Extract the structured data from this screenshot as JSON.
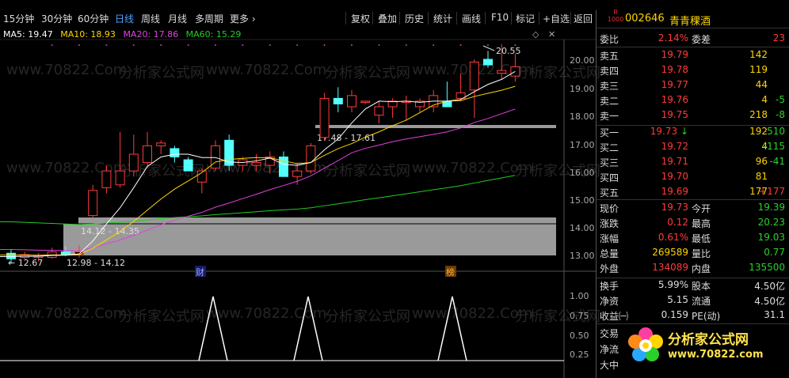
{
  "toolbar": {
    "periods": [
      "15分钟",
      "30分钟",
      "60分钟",
      "日线",
      "周线",
      "月线",
      "多周期",
      "更多 ›"
    ],
    "active_period": "日线",
    "buttons": [
      "复权",
      "叠加",
      "历史",
      "统计",
      "画线",
      "F10",
      "标记",
      "+自选",
      "返回"
    ]
  },
  "ma_legend": {
    "ma5": "MA5: 19.47",
    "ma10": "MA10: 18.93",
    "ma20": "MA20: 17.86",
    "ma60": "MA60: 15.29",
    "colors": {
      "ma5": "#ffffff",
      "ma10": "#ffd400",
      "ma20": "#e040e0",
      "ma60": "#22cc22"
    }
  },
  "chart_data": {
    "type": "candlestick",
    "price_axis_ticks": [
      "20.00",
      "19.00",
      "18.00",
      "17.00",
      "16.00",
      "15.00",
      "14.00",
      "13.00"
    ],
    "ylim": [
      12.6,
      20.9
    ],
    "annotations": {
      "high_label": "20.55",
      "low_label": "← 12.67",
      "range_band_top": "17.48 - 17.61",
      "range_band_mid": "14.12 - 14.35",
      "range_band_low": "12.98 - 14.12"
    },
    "event_markers": [
      "财",
      "榜"
    ],
    "indicator_axis_ticks": [
      "1.00",
      "0.75",
      "0.50",
      "0.25"
    ],
    "indicator_peaks": [
      0,
      0,
      1,
      0,
      0,
      1,
      0,
      0,
      1,
      0
    ],
    "candles": [
      {
        "o": 13.05,
        "h": 13.2,
        "l": 12.67,
        "c": 12.85
      },
      {
        "o": 12.9,
        "h": 13.1,
        "l": 12.8,
        "c": 13.0
      },
      {
        "o": 12.9,
        "h": 13.05,
        "l": 12.75,
        "c": 12.95
      },
      {
        "o": 12.9,
        "h": 13.25,
        "l": 12.85,
        "c": 13.1
      },
      {
        "o": 13.1,
        "h": 13.3,
        "l": 12.95,
        "c": 13.0
      },
      {
        "o": 13.0,
        "h": 13.35,
        "l": 12.9,
        "c": 13.1
      },
      {
        "o": 14.4,
        "h": 15.5,
        "l": 14.3,
        "c": 15.3
      },
      {
        "o": 15.4,
        "h": 16.2,
        "l": 15.2,
        "c": 16.0
      },
      {
        "o": 15.5,
        "h": 17.4,
        "l": 15.4,
        "c": 16.0
      },
      {
        "o": 16.0,
        "h": 17.3,
        "l": 15.8,
        "c": 16.6
      },
      {
        "o": 16.3,
        "h": 17.4,
        "l": 16.1,
        "c": 16.9
      },
      {
        "o": 16.9,
        "h": 17.1,
        "l": 16.6,
        "c": 17.0
      },
      {
        "o": 16.8,
        "h": 16.9,
        "l": 16.3,
        "c": 16.5
      },
      {
        "o": 16.4,
        "h": 16.5,
        "l": 16.0,
        "c": 16.0
      },
      {
        "o": 15.6,
        "h": 16.1,
        "l": 15.2,
        "c": 16.0
      },
      {
        "o": 16.1,
        "h": 17.1,
        "l": 16.0,
        "c": 16.9
      },
      {
        "o": 17.1,
        "h": 17.3,
        "l": 16.0,
        "c": 16.2
      },
      {
        "o": 16.2,
        "h": 16.5,
        "l": 16.0,
        "c": 16.4
      },
      {
        "o": 16.2,
        "h": 16.6,
        "l": 16.0,
        "c": 16.3
      },
      {
        "o": 16.2,
        "h": 16.7,
        "l": 15.9,
        "c": 16.5
      },
      {
        "o": 16.5,
        "h": 16.7,
        "l": 15.8,
        "c": 15.8
      },
      {
        "o": 15.8,
        "h": 16.3,
        "l": 15.5,
        "c": 16.0
      },
      {
        "o": 16.0,
        "h": 17.0,
        "l": 15.9,
        "c": 16.9
      },
      {
        "o": 17.2,
        "h": 18.8,
        "l": 17.1,
        "c": 18.6
      },
      {
        "o": 18.6,
        "h": 19.0,
        "l": 18.1,
        "c": 18.4
      },
      {
        "o": 18.3,
        "h": 18.9,
        "l": 18.1,
        "c": 18.7
      },
      {
        "o": 18.5,
        "h": 18.5,
        "l": 18.4,
        "c": 18.5
      },
      {
        "o": 18.0,
        "h": 18.5,
        "l": 17.7,
        "c": 18.3
      },
      {
        "o": 18.3,
        "h": 18.6,
        "l": 17.9,
        "c": 18.5
      },
      {
        "o": 18.5,
        "h": 18.7,
        "l": 17.8,
        "c": 18.5
      },
      {
        "o": 18.3,
        "h": 18.6,
        "l": 18.1,
        "c": 18.5
      },
      {
        "o": 18.3,
        "h": 18.9,
        "l": 18.1,
        "c": 18.7
      },
      {
        "o": 18.5,
        "h": 19.2,
        "l": 18.3,
        "c": 18.3
      },
      {
        "o": 18.6,
        "h": 19.5,
        "l": 18.5,
        "c": 18.8
      },
      {
        "o": 18.9,
        "h": 20.0,
        "l": 17.9,
        "c": 19.9
      },
      {
        "o": 20.0,
        "h": 20.3,
        "l": 19.7,
        "c": 19.8
      },
      {
        "o": 19.5,
        "h": 20.55,
        "l": 19.3,
        "c": 19.6
      },
      {
        "o": 19.4,
        "h": 20.2,
        "l": 19.2,
        "c": 19.73
      }
    ]
  },
  "quote": {
    "badge_top": "R",
    "badge_bottom": "1000",
    "code": "002646",
    "name": "青青稞酒",
    "wei_bi_label": "委比",
    "wei_bi": "2.14%",
    "wei_cha_label": "委差",
    "wei_cha": "23",
    "asks": [
      {
        "label": "卖五",
        "price": "19.79",
        "vol": "142",
        "chg": ""
      },
      {
        "label": "卖四",
        "price": "19.78",
        "vol": "119",
        "chg": ""
      },
      {
        "label": "卖三",
        "price": "19.77",
        "vol": "44",
        "chg": ""
      },
      {
        "label": "卖二",
        "price": "19.76",
        "vol": "4",
        "chg": "-5"
      },
      {
        "label": "卖一",
        "price": "19.75",
        "vol": "218",
        "chg": "-8"
      }
    ],
    "bids": [
      {
        "label": "买一",
        "price": "19.73",
        "arrow": "↓",
        "vol": "192",
        "chg": "-510"
      },
      {
        "label": "买二",
        "price": "19.72",
        "arrow": "",
        "vol": "4",
        "chg": "-115"
      },
      {
        "label": "买三",
        "price": "19.71",
        "arrow": "",
        "vol": "96",
        "chg": "-41"
      },
      {
        "label": "买四",
        "price": "19.70",
        "arrow": "",
        "vol": "81",
        "chg": ""
      },
      {
        "label": "买五",
        "price": "19.69",
        "arrow": "",
        "vol": "177",
        "chg": "+177"
      }
    ],
    "stats": [
      {
        "l1": "现价",
        "v1": "19.73",
        "c1": "red",
        "l2": "今开",
        "v2": "19.39",
        "c2": "green"
      },
      {
        "l1": "涨跌",
        "v1": "0.12",
        "c1": "red",
        "l2": "最高",
        "v2": "20.23",
        "c2": "green"
      },
      {
        "l1": "涨幅",
        "v1": "0.61%",
        "c1": "red",
        "l2": "最低",
        "v2": "19.03",
        "c2": "green"
      },
      {
        "l1": "总量",
        "v1": "269589",
        "c1": "yellow",
        "l2": "量比",
        "v2": "0.77",
        "c2": "green"
      },
      {
        "l1": "外盘",
        "v1": "134089",
        "c1": "red",
        "l2": "内盘",
        "v2": "135500",
        "c2": "green"
      }
    ],
    "stats2": [
      {
        "l1": "换手",
        "v1": "5.99%",
        "l2": "股本",
        "v2": "4.50亿"
      },
      {
        "l1": "净资",
        "v1": "5.15",
        "l2": "流通",
        "v2": "4.50亿"
      },
      {
        "l1": "收益㈠",
        "v1": "0.159",
        "l2": "PE(动)",
        "v2": "31.1"
      }
    ],
    "extra_labels": [
      "交易",
      "净流",
      "大中"
    ]
  },
  "watermark": {
    "url": "www.70822.Com",
    "cn": "分析家公式网"
  },
  "logo": {
    "title": "分析家公式网",
    "url": "www.70822.com"
  }
}
